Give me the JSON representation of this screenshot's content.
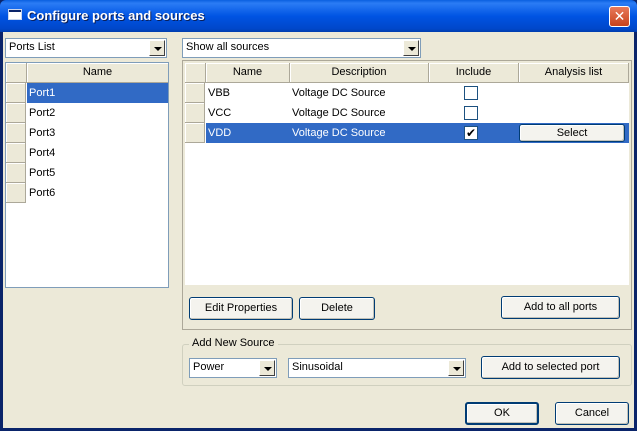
{
  "window": {
    "title": "Configure ports and sources",
    "close_label": "✕"
  },
  "ports": {
    "filter": "Ports List",
    "header": "Name",
    "items": [
      "Port1",
      "Port2",
      "Port3",
      "Port4",
      "Port5",
      "Port6"
    ],
    "selected_index": 0
  },
  "sources": {
    "filter": "Show all sources",
    "headers": {
      "name": "Name",
      "description": "Description",
      "include": "Include",
      "analysis": "Analysis list"
    },
    "rows": [
      {
        "name": "VBB",
        "description": "Voltage DC Source",
        "include": false,
        "analysis_button": ""
      },
      {
        "name": "VCC",
        "description": "Voltage DC Source",
        "include": false,
        "analysis_button": ""
      },
      {
        "name": "VDD",
        "description": "Voltage DC Source",
        "include": true,
        "analysis_button": "Select"
      }
    ],
    "selected_index": 2
  },
  "actions": {
    "edit_properties": "Edit Properties",
    "delete": "Delete",
    "add_to_all_ports": "Add to all ports"
  },
  "add_new_source": {
    "legend": "Add New Source",
    "type": "Power",
    "waveform": "Sinusoidal",
    "add_button": "Add to selected port"
  },
  "dialog": {
    "ok": "OK",
    "cancel": "Cancel"
  },
  "colors": {
    "selection": "#316ac5",
    "titlebar": "#0054e3",
    "face": "#ece9d8"
  }
}
